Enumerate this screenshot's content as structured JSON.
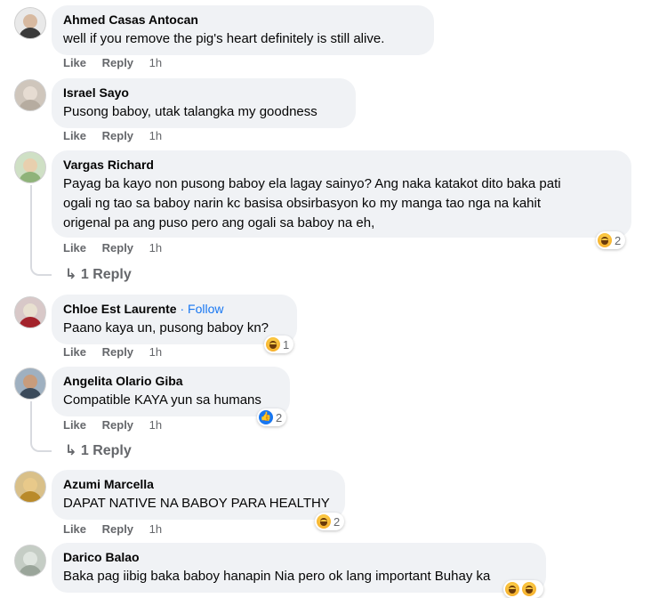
{
  "comments": [
    {
      "name": "Ahmed Casas Antocan",
      "follow": "",
      "text": [
        "well if you remove the pig's heart definitely is still alive."
      ],
      "like": "Like",
      "reply": "Reply",
      "time": "1h",
      "avatar_colors": [
        "#3a3a3a",
        "#d7b9a0"
      ]
    },
    {
      "name": "Israel Sayo",
      "follow": "",
      "text": [
        "Pusong baboy, utak talangka my goodness"
      ],
      "like": "Like",
      "reply": "Reply",
      "time": "1h",
      "avatar_colors": [
        "#b6aca0",
        "#e6dcd2"
      ]
    },
    {
      "name": "Vargas Richard",
      "follow": "",
      "text": [
        "Payag ba kayo non pusong baboy ela lagay sainyo? Ang naka katakot dito baka pati",
        "ogali ng tao sa baboy narin kc basisa obsirbasyon ko my manga tao nga na kahit",
        "origenal pa ang puso pero ang ogali sa baboy na eh,"
      ],
      "like": "Like",
      "reply": "Reply",
      "time": "1h",
      "reaction": {
        "type": "haha",
        "count": "2"
      },
      "replies": "1 Reply",
      "avatar_colors": [
        "#8fb37a",
        "#e8cfae"
      ]
    },
    {
      "name": "Chloe Est Laurente",
      "follow": "Follow",
      "text": [
        "Paano kaya un, pusong baboy kn?"
      ],
      "like": "Like",
      "reply": "Reply",
      "time": "1h",
      "reaction": {
        "type": "haha",
        "count": "1"
      },
      "avatar_colors": [
        "#a3232b",
        "#e8e0d0"
      ]
    },
    {
      "name": "Angelita Olario Giba",
      "follow": "",
      "text": [
        "Compatible KAYA yun sa humans"
      ],
      "like": "Like",
      "reply": "Reply",
      "time": "1h",
      "reaction": {
        "type": "like",
        "count": "2"
      },
      "replies": "1 Reply",
      "avatar_colors": [
        "#3b4a5a",
        "#c89c7c"
      ]
    },
    {
      "name": "Azumi Marcella",
      "follow": "",
      "text": [
        "DAPAT NATIVE NA BABOY PARA HEALTHY"
      ],
      "like": "Like",
      "reply": "Reply",
      "time": "1h",
      "reaction": {
        "type": "haha",
        "count": "2"
      },
      "avatar_colors": [
        "#b98a2a",
        "#e8c98a"
      ]
    },
    {
      "name": "Darico Balao",
      "follow": "",
      "text": [
        "Baka pag iibig baka baboy hanapin Nia pero ok lang important Buhay ka"
      ],
      "like": "",
      "reply": "",
      "time": "",
      "avatar_colors": [
        "#9aa59a",
        "#dfe5df"
      ]
    }
  ],
  "separator": "·",
  "like_icon_glyph": "👍"
}
